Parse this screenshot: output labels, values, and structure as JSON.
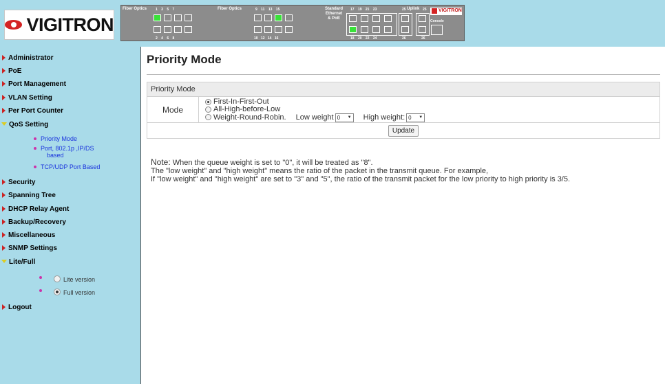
{
  "header": {
    "brand": "VIGITRON",
    "panel": {
      "fiber_label_1": "Fiber Optics",
      "fiber_label_2": "Fiber Optics",
      "std_label_1": "Standard",
      "std_label_2": "Ethernet",
      "std_label_3": "& PoE",
      "uplink_label": "Uplink",
      "console_label": "Console",
      "panel_brand": "VIGITRON",
      "top_nums_1": "1  3  5  7",
      "top_nums_2": "9  11  13  15",
      "top_nums_3": "17  19  21  23",
      "top_num_25": "25",
      "top_num_25b": "25",
      "bot_nums_1": "2  4  6  8",
      "bot_nums_2": "10  12  14  16",
      "bot_nums_3": "18  20  22  24",
      "bot_num_26": "26",
      "bot_num_26b": "26"
    }
  },
  "sidebar": {
    "items": [
      {
        "label": "Administrator"
      },
      {
        "label": "PoE"
      },
      {
        "label": "Port Management"
      },
      {
        "label": "VLAN Setting"
      },
      {
        "label": "Per Port Counter"
      },
      {
        "label": "QoS Setting"
      },
      {
        "label": "Security"
      },
      {
        "label": "Spanning Tree"
      },
      {
        "label": "DHCP Relay Agent"
      },
      {
        "label": "Backup/Recovery"
      },
      {
        "label": "Miscellaneous"
      },
      {
        "label": "SNMP Settings"
      },
      {
        "label": "Lite/Full"
      },
      {
        "label": "Logout"
      }
    ],
    "qos_sub": {
      "priority_mode": "Priority Mode",
      "port_based_1": "Port, 802.1p ,IP/DS",
      "port_based_2": "based",
      "tcp_udp": "TCP/UDP Port Based"
    },
    "lite_full": {
      "lite": "Lite version",
      "full": "Full version"
    }
  },
  "main": {
    "title": "Priority Mode",
    "card_title": "Priority Mode",
    "mode_label": "Mode",
    "options": {
      "fifo": "First-In-First-Out",
      "high_before_low": "All-High-before-Low",
      "wrr": "Weight-Round-Robin."
    },
    "low_weight_label": "Low weight",
    "low_weight_value": "0",
    "high_weight_label": "High weight:",
    "high_weight_value": "0",
    "update_label": "Update",
    "note_label": "Note:",
    "note_1": " When the queue weight is set to \"0\", it will be treated as \"8\".",
    "note_2": "The \"low weight\" and \"high weight\" means the ratio of the packet in the transmit queue. For example,",
    "note_3": "If \"low weight\" and \"high weight\" are set to \"3\" and \"5\", the ratio of the transmit packet for the low priority to high priority is 3/5."
  },
  "colors": {
    "sidebar_bg": "#a9dbe9",
    "brand_red": "#d42323",
    "link_blue": "#1a33dd",
    "port_active": "#39e239"
  }
}
